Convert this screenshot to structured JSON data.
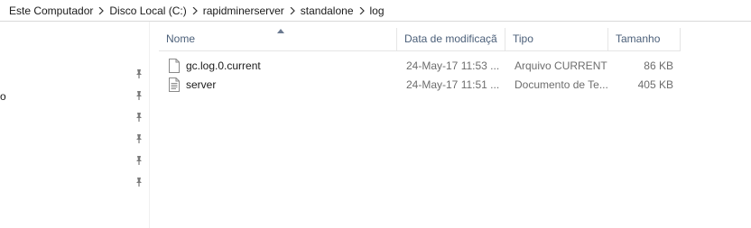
{
  "breadcrumb": {
    "items": [
      "Este Computador",
      "Disco Local (C:)",
      "rapidminerserver",
      "standalone",
      "log"
    ]
  },
  "nav": {
    "fragment": "o",
    "pin_count": 6
  },
  "columns": {
    "name": "Nome",
    "date": "Data de modificaçã",
    "type": "Tipo",
    "size": "Tamanho"
  },
  "files": [
    {
      "name": "gc.log.0.current",
      "date": "24-May-17 11:53 ...",
      "type": "Arquivo CURRENT",
      "size": "86 KB",
      "icon": "blank-file-icon"
    },
    {
      "name": "server",
      "date": "24-May-17 11:51 ...",
      "type": "Documento de Te...",
      "size": "405 KB",
      "icon": "text-file-icon"
    }
  ],
  "colors": {
    "header_text": "#4c607a",
    "detail_text": "#6d6d6d"
  }
}
